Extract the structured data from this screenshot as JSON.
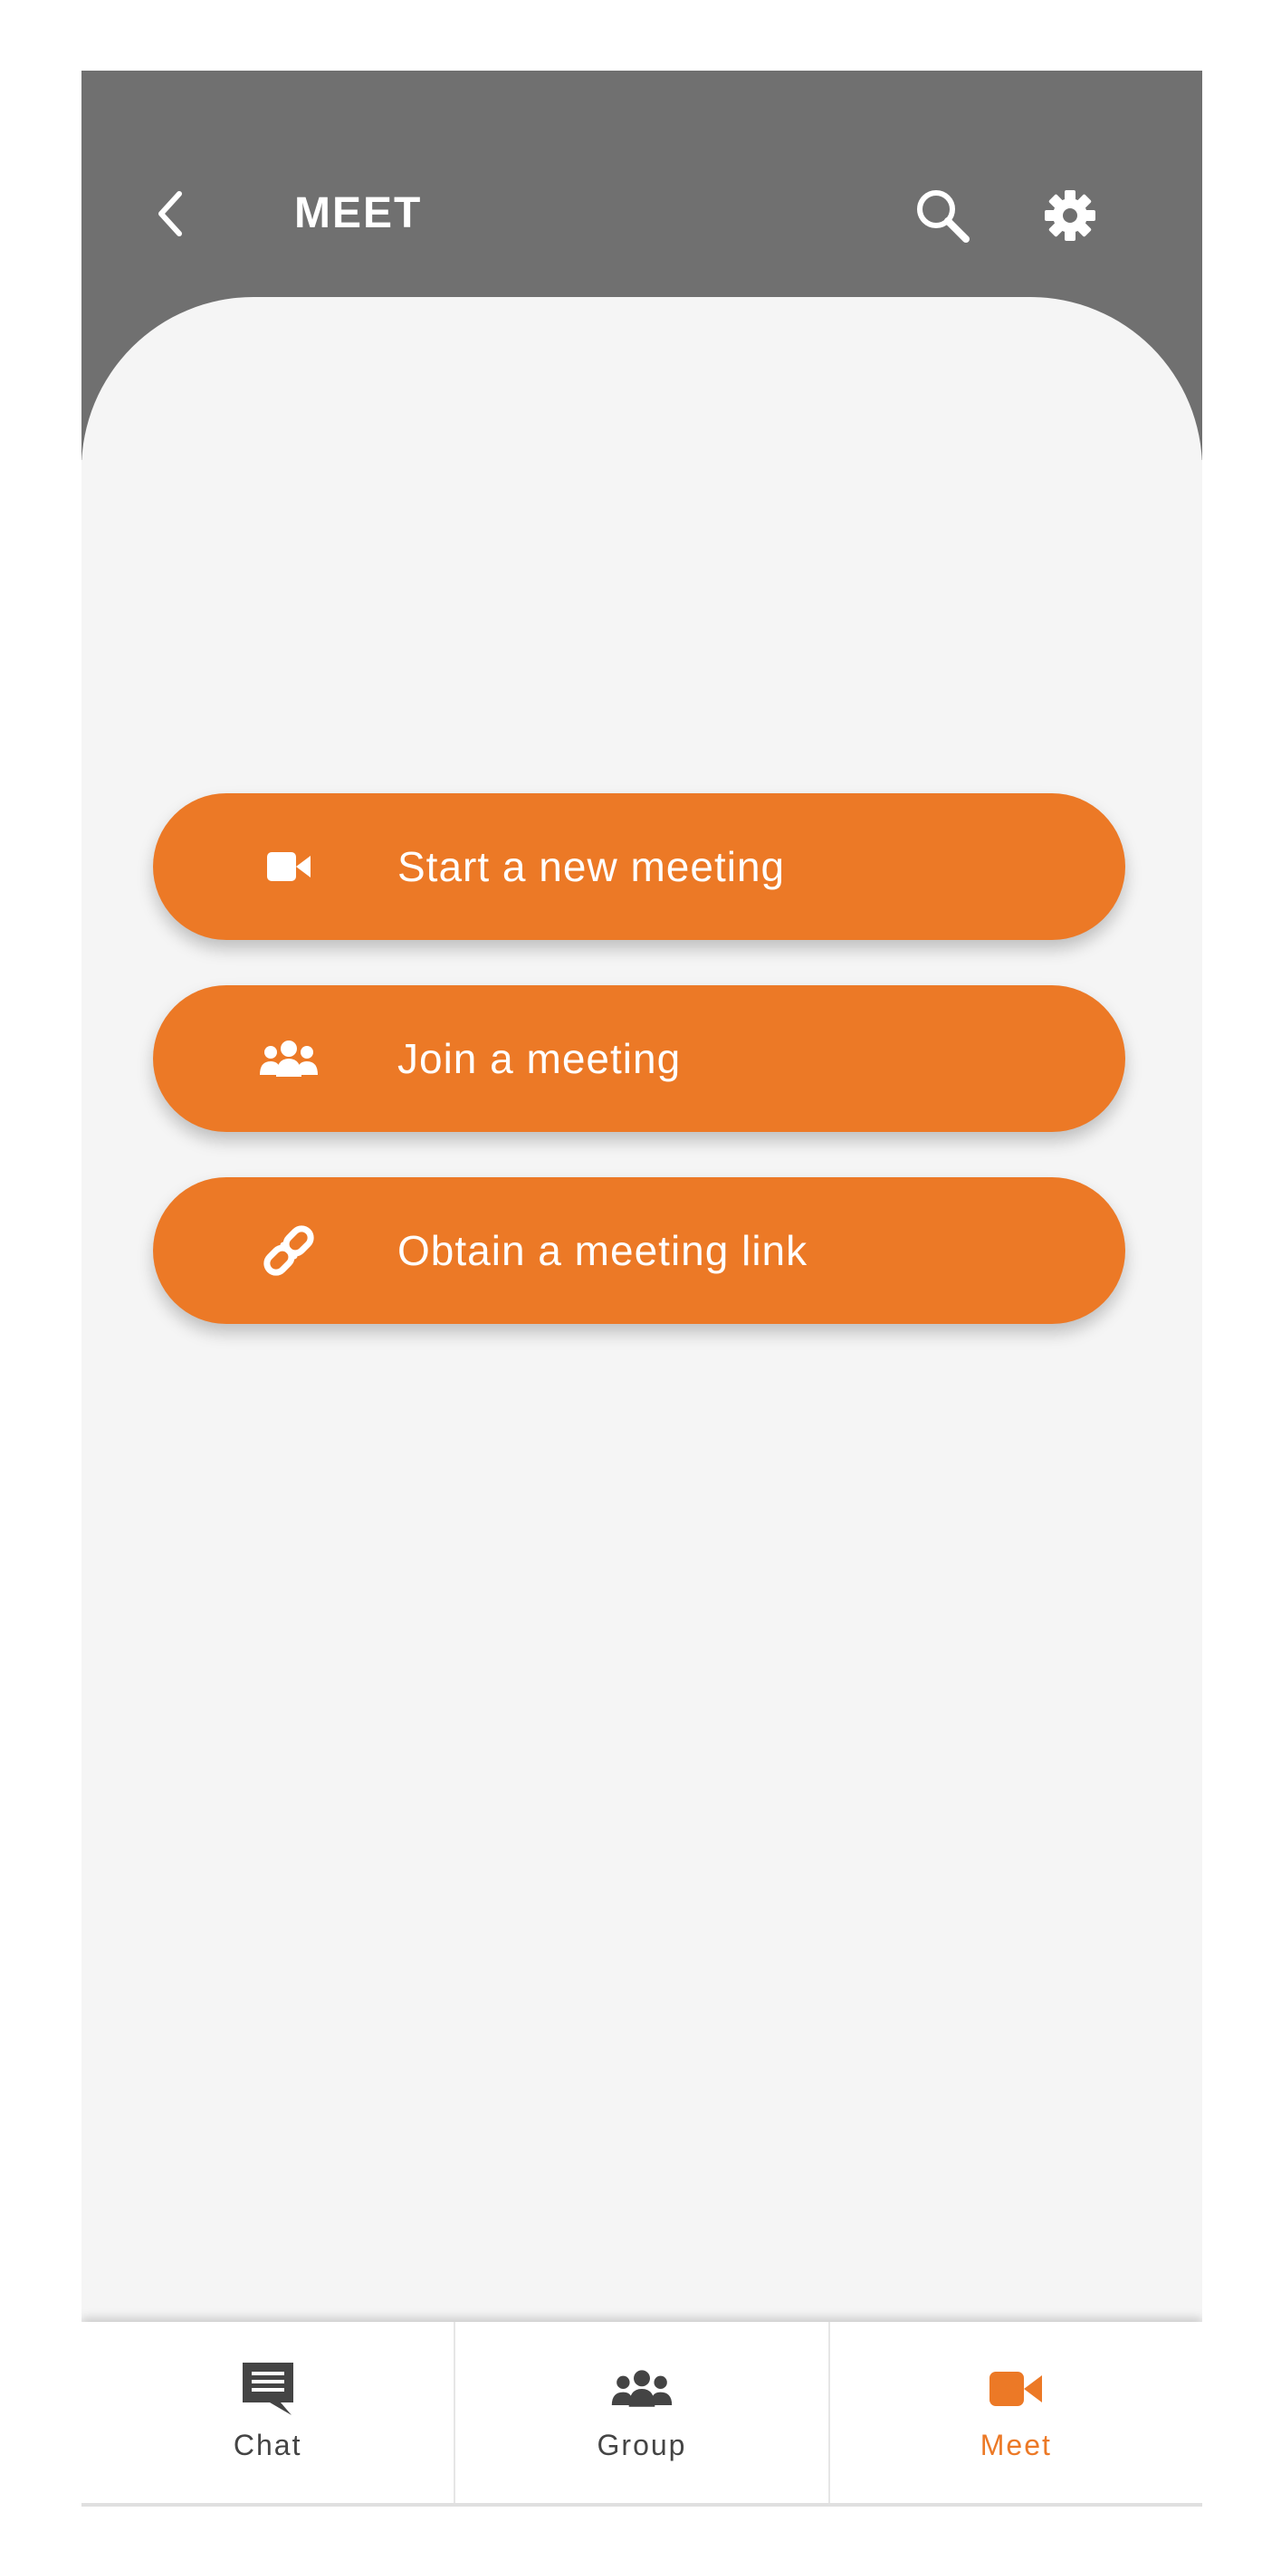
{
  "header": {
    "title": "MEET",
    "back_icon": "chevron-left-icon",
    "search_icon": "search-icon",
    "settings_icon": "gear-icon",
    "background": "#707070"
  },
  "actions": [
    {
      "label": "Start a new meeting",
      "icon": "video-camera-icon"
    },
    {
      "label": "Join a meeting",
      "icon": "users-icon"
    },
    {
      "label": "Obtain a meeting link",
      "icon": "link-icon"
    }
  ],
  "bottom_nav": {
    "items": [
      {
        "label": "Chat",
        "icon": "chat-icon",
        "active": false
      },
      {
        "label": "Group",
        "icon": "group-icon",
        "active": false
      },
      {
        "label": "Meet",
        "icon": "video-camera-icon",
        "active": true
      }
    ]
  },
  "colors": {
    "accent": "#ec7926",
    "inactive": "#444444",
    "background": "#f5f5f5"
  }
}
